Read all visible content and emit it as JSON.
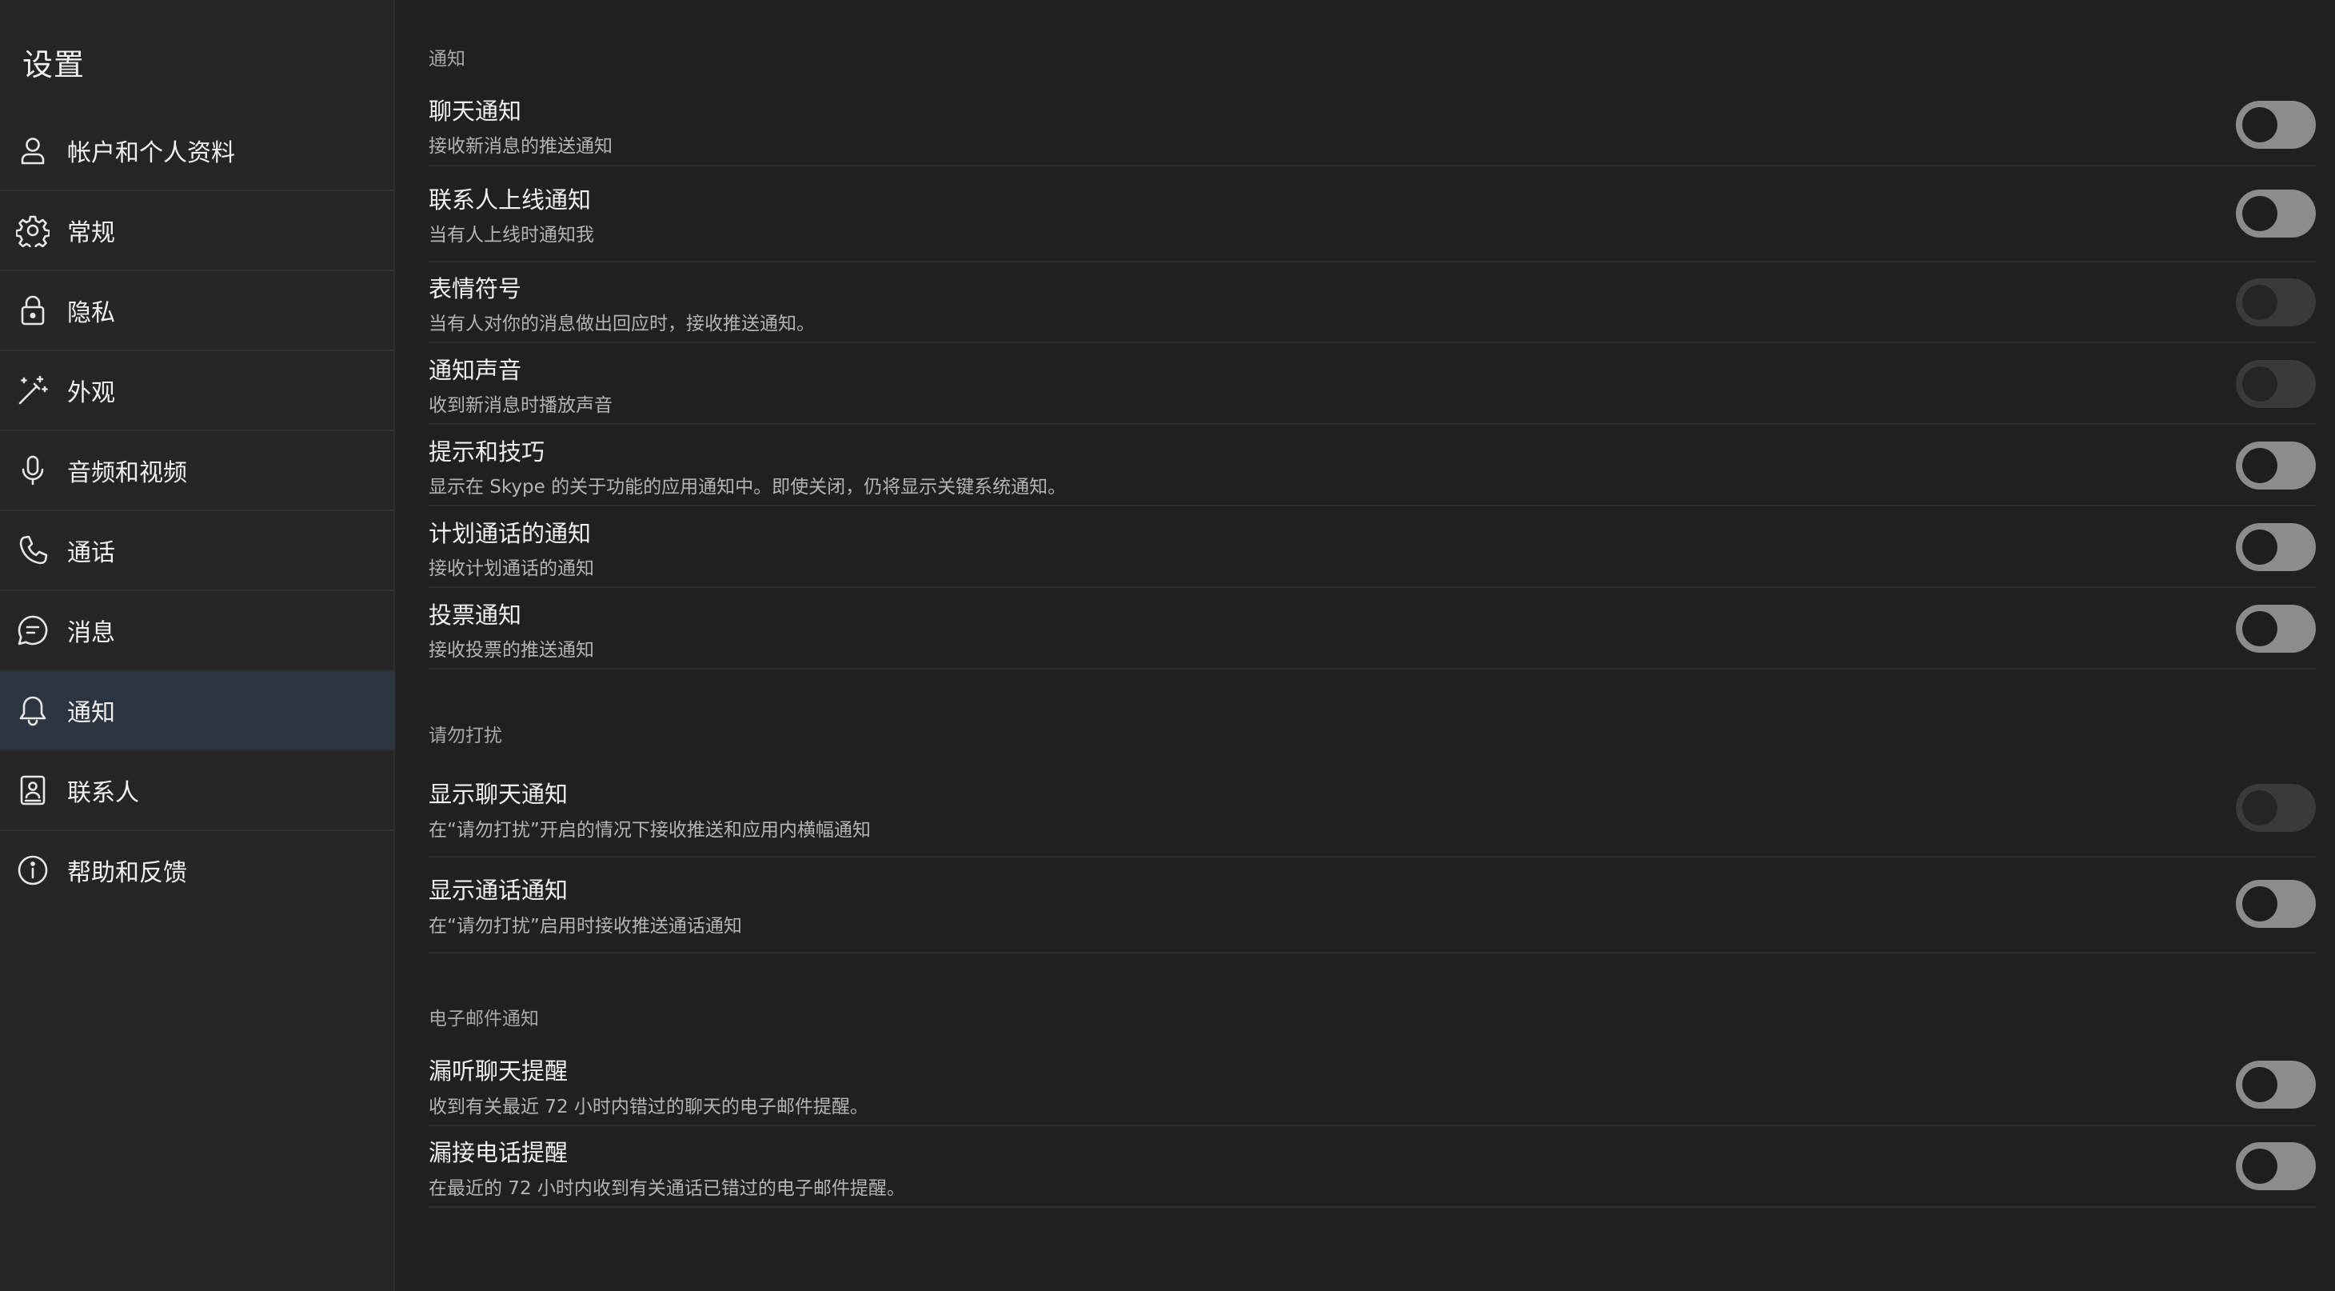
{
  "sidebar": {
    "title": "设置",
    "items": [
      {
        "label": "帐户和个人资料",
        "icon": "person-icon"
      },
      {
        "label": "常规",
        "icon": "gear-icon"
      },
      {
        "label": "隐私",
        "icon": "lock-icon"
      },
      {
        "label": "外观",
        "icon": "magic-wand-icon"
      },
      {
        "label": "音频和视频",
        "icon": "microphone-icon"
      },
      {
        "label": "通话",
        "icon": "phone-icon"
      },
      {
        "label": "消息",
        "icon": "chat-bubble-icon"
      },
      {
        "label": "通知",
        "icon": "bell-icon",
        "active": true
      },
      {
        "label": "联系人",
        "icon": "contact-book-icon"
      },
      {
        "label": "帮助和反馈",
        "icon": "info-icon"
      }
    ]
  },
  "sections": {
    "notifications": {
      "header": "通知",
      "rows": [
        {
          "title": "聊天通知",
          "desc": "接收新消息的推送通知",
          "enabled": false,
          "disabled": false
        },
        {
          "title": "联系人上线通知",
          "desc": "当有人上线时通知我",
          "enabled": false,
          "disabled": false
        },
        {
          "title": "表情符号",
          "desc": "当有人对你的消息做出回应时，接收推送通知。",
          "enabled": false,
          "disabled": true
        },
        {
          "title": "通知声音",
          "desc": "收到新消息时播放声音",
          "enabled": false,
          "disabled": true
        },
        {
          "title": "提示和技巧",
          "desc": "显示在 Skype 的关于功能的应用通知中。即使关闭，仍将显示关键系统通知。",
          "enabled": false,
          "disabled": false
        },
        {
          "title": "计划通话的通知",
          "desc": "接收计划通话的通知",
          "enabled": false,
          "disabled": false
        },
        {
          "title": "投票通知",
          "desc": "接收投票的推送通知",
          "enabled": false,
          "disabled": false
        }
      ]
    },
    "dnd": {
      "header": "请勿打扰",
      "rows": [
        {
          "title": "显示聊天通知",
          "desc": "在“请勿打扰”开启的情况下接收推送和应用内横幅通知",
          "enabled": false,
          "disabled": true
        },
        {
          "title": "显示通话通知",
          "desc": "在“请勿打扰”启用时接收推送通话通知",
          "enabled": false,
          "disabled": false
        }
      ]
    },
    "email": {
      "header": "电子邮件通知",
      "rows": [
        {
          "title": "漏听聊天提醒",
          "desc": "收到有关最近 72 小时内错过的聊天的电子邮件提醒。",
          "enabled": false,
          "disabled": false
        },
        {
          "title": "漏接电话提醒",
          "desc": "在最近的 72 小时内收到有关通话已错过的电子邮件提醒。",
          "enabled": false,
          "disabled": false
        }
      ]
    }
  },
  "colors": {
    "background": "#202020",
    "sidebar": "#252525",
    "active_item": "#2c3440",
    "toggle_off": "#8c8c8c",
    "toggle_disabled": "#3a3a3a"
  }
}
